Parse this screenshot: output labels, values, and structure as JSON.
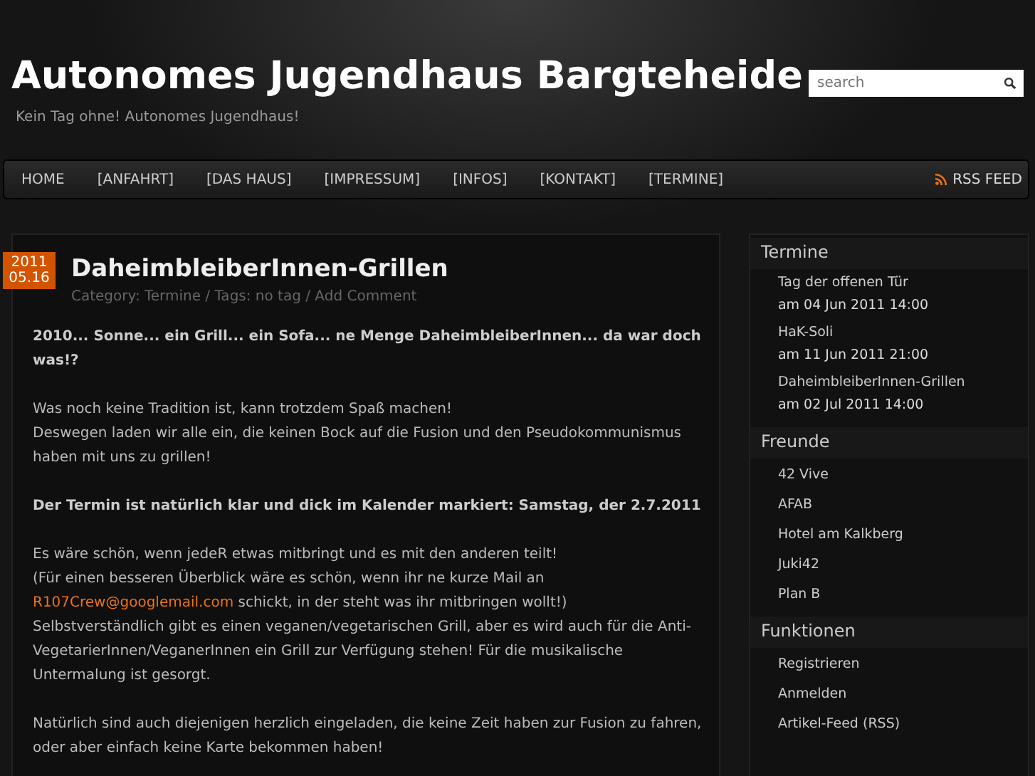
{
  "header": {
    "title": "Autonomes Jugendhaus Bargteheide",
    "tagline": "Kein Tag ohne! Autonomes Jugendhaus!",
    "search": {
      "placeholder": "search"
    }
  },
  "nav": {
    "items": [
      {
        "label": "HOME",
        "selected": false
      },
      {
        "label": "[ANFAHRT]",
        "selected": false
      },
      {
        "label": "[DAS HAUS]",
        "selected": false
      },
      {
        "label": "[IMPRESSUM]",
        "selected": false
      },
      {
        "label": "[INFOS]",
        "selected": false
      },
      {
        "label": "[KONTAKT]",
        "selected": false
      },
      {
        "label": "[TERMINE]",
        "selected": false
      }
    ],
    "rss": "RSS FEED"
  },
  "post": {
    "date_year": "2011",
    "date_day": "05.16",
    "title": "DaheimbleiberInnen-Grillen",
    "meta": "Category: Termine / Tags: no tag / Add Comment",
    "paragraphs": [
      {
        "kind": "bold",
        "lines": [
          [
            {
              "text": "2010... Sonne... ein Grill... ein Sofa... ne Menge DaheimbleiberInnen... da war doch was!?",
              "kind": "text"
            }
          ]
        ]
      },
      {
        "kind": "plain",
        "lines": [
          [
            {
              "text": "Was noch keine Tradition ist, kann trotzdem Spaß machen!",
              "kind": "text"
            }
          ],
          [
            {
              "text": "Deswegen laden wir alle ein, die keinen Bock auf die Fusion und den Pseudokommunismus haben mit uns zu grillen!",
              "kind": "text"
            }
          ]
        ]
      },
      {
        "kind": "bold",
        "lines": [
          [
            {
              "text": "Der Termin ist natürlich klar und dick im Kalender markiert: Samstag, der 2.7.2011",
              "kind": "text"
            }
          ]
        ]
      },
      {
        "kind": "plain",
        "lines": [
          [
            {
              "text": "Es wäre schön, wenn jedeR etwas mitbringt und es mit den anderen teilt!",
              "kind": "text"
            }
          ],
          [
            {
              "text": "(Für einen besseren Überblick wäre es schön, wenn ihr ne kurze Mail an",
              "kind": "text"
            }
          ],
          [
            {
              "text": "R107Crew@googlemail.com",
              "kind": "link"
            },
            {
              "text": " schickt, in der steht was ihr mitbringen wollt!)",
              "kind": "text"
            }
          ],
          [
            {
              "text": "Selbstverständlich gibt es einen veganen/vegetarischen Grill, aber es wird auch für die Anti-VegetarierInnen/VeganerInnen ein Grill zur Verfügung stehen! Für die musikalische Untermalung ist gesorgt.",
              "kind": "text"
            }
          ]
        ]
      },
      {
        "kind": "plain",
        "lines": [
          [
            {
              "text": "Natürlich sind auch diejenigen herzlich eingeladen, die keine Zeit haben zur Fusion zu fahren, oder aber einfach keine Karte bekommen haben!",
              "kind": "text"
            }
          ]
        ]
      }
    ]
  },
  "sidebar": [
    {
      "title": "Termine",
      "items": [
        {
          "label": "Tag der offenen Tür",
          "date": "am 04 Jun 2011 14:00"
        },
        {
          "label": "HaK-Soli",
          "date": "am 11 Jun 2011 21:00"
        },
        {
          "label": "DaheimbleiberInnen-Grillen",
          "date": "am 02 Jul 2011 14:00"
        }
      ]
    },
    {
      "title": "Freunde",
      "items": [
        {
          "label": "42 Vive"
        },
        {
          "label": "AFAB"
        },
        {
          "label": "Hotel am Kalkberg"
        },
        {
          "label": "Juki42"
        },
        {
          "label": "Plan B"
        }
      ]
    },
    {
      "title": "Funktionen",
      "items": [
        {
          "label": "Registrieren"
        },
        {
          "label": "Anmelden"
        },
        {
          "label": "Artikel-Feed (RSS)"
        }
      ]
    }
  ]
}
